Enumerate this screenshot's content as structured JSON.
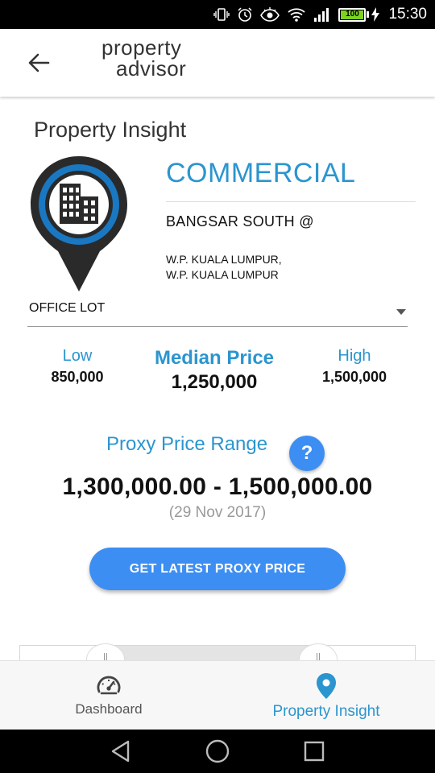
{
  "status_bar": {
    "battery_level": "100",
    "time": "15:30",
    "icons": [
      "vibrate-icon",
      "alarm-icon",
      "eye-icon",
      "wifi-icon",
      "signal-icon",
      "battery-icon",
      "charging-icon"
    ]
  },
  "app_bar": {
    "back_icon": "arrow-left-icon",
    "logo_line1": "property",
    "logo_line2": "advisor"
  },
  "insight": {
    "section_title": "Property Insight",
    "category": "COMMERCIAL",
    "property_name": "BANGSAR SOUTH @",
    "address_line1": "W.P. KUALA LUMPUR,",
    "address_line2": "W.P. KUALA LUMPUR",
    "property_type": "OFFICE LOT",
    "icon": "building-location-pin-icon"
  },
  "prices": {
    "low_label": "Low",
    "low_value": "850,000",
    "median_label": "Median Price",
    "median_value": "1,250,000",
    "high_label": "High",
    "high_value": "1,500,000"
  },
  "proxy": {
    "title": "Proxy Price Range",
    "help_label": "?",
    "range": "1,300,000.00 - 1,500,000.00",
    "date": "(29 Nov 2017)",
    "cta_label": "GET LATEST PROXY PRICE"
  },
  "bottom_nav": {
    "items": [
      {
        "label": "Dashboard",
        "icon": "speedometer-icon",
        "active": false
      },
      {
        "label": "Property Insight",
        "icon": "location-pin-icon",
        "active": true
      }
    ]
  },
  "colors": {
    "accent": "#2b95cf",
    "button": "#3d8ef2",
    "pin_ring": "#1a78c2",
    "pin_dark": "#2a2a2a",
    "battery": "#7ed321"
  }
}
